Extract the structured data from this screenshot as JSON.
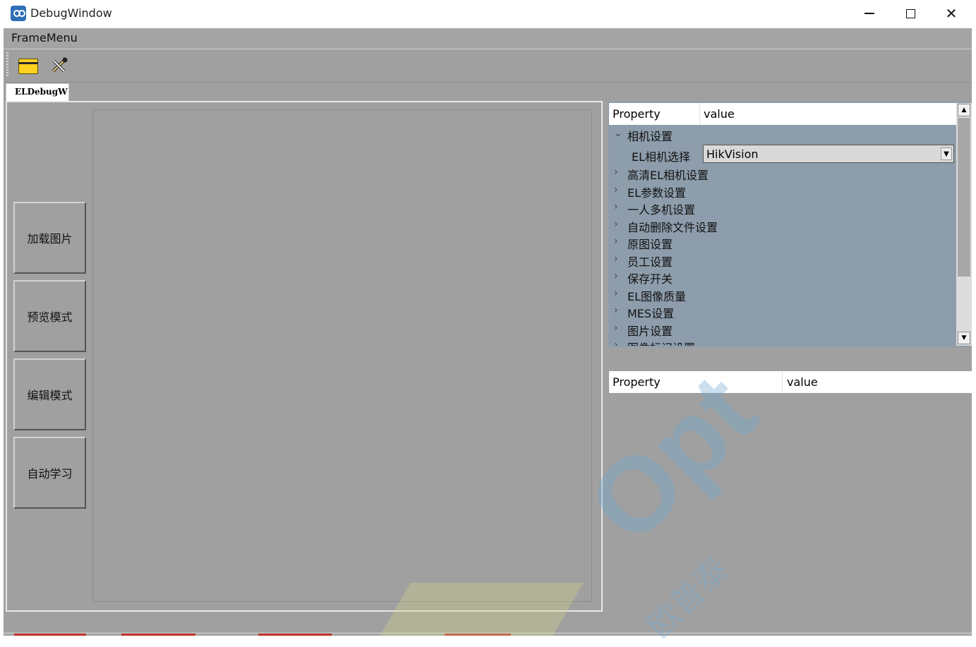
{
  "window": {
    "title": "DebugWindow",
    "minimize": "minimize",
    "maximize": "maximize",
    "close": "✕"
  },
  "menu": {
    "items": [
      "FrameMenu"
    ]
  },
  "toolbar": {
    "icons": [
      "folder-icon",
      "wrench-icon"
    ]
  },
  "tabs": [
    {
      "label": "ELDebugW"
    }
  ],
  "side_buttons": [
    "加载图片",
    "预览模式",
    "编辑模式",
    "自动学习"
  ],
  "property_grid_top": {
    "header": {
      "property": "Property",
      "value": "value"
    },
    "expanded_group": "相机设置",
    "camera_select": {
      "label": "EL相机选择",
      "value": "HikVision"
    },
    "groups": [
      "高清EL相机设置",
      "EL参数设置",
      "一人多机设置",
      "自动删除文件设置",
      "原图设置",
      "员工设置",
      "保存开关",
      "EL图像质量",
      "MES设置",
      "图片设置",
      "图像标记设置"
    ]
  },
  "property_grid_bottom": {
    "header": {
      "property": "Property",
      "value": "value"
    }
  },
  "watermark": {
    "logo": "Opt",
    "chinese": "欧普泰"
  },
  "colors": {
    "title_bg": "#ffffff",
    "frame_bg": "#a0a0a0",
    "grid_selection": "#8d9dab",
    "watermark": "#6fa9d6"
  }
}
